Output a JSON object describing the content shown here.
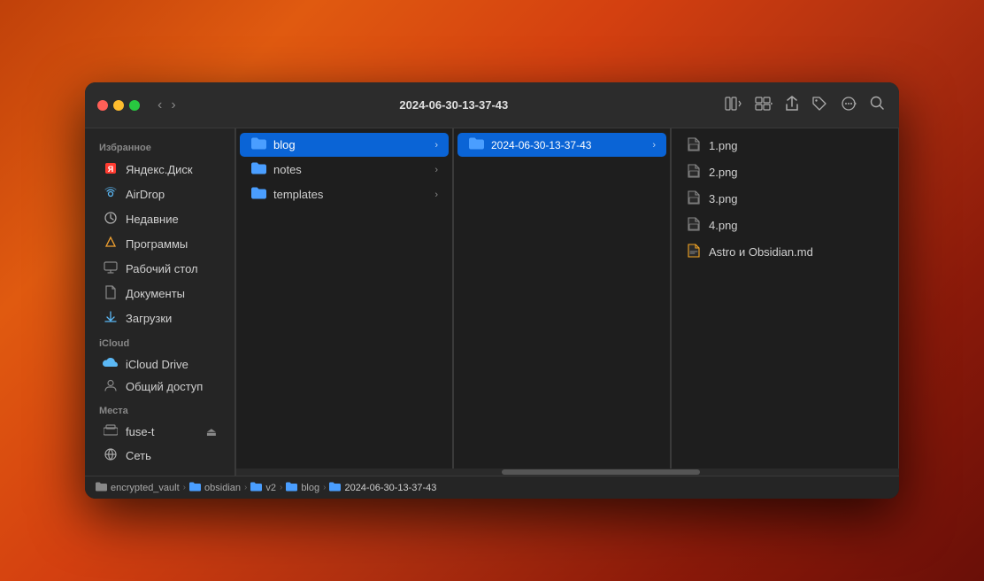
{
  "window": {
    "title": "2024-06-30-13-37-43",
    "traffic_lights": {
      "close_label": "close",
      "minimize_label": "minimize",
      "maximize_label": "maximize"
    }
  },
  "toolbar": {
    "back_label": "‹",
    "forward_label": "›",
    "title": "2024-06-30-13-37-43",
    "share_icon": "↑",
    "tag_icon": "⌲",
    "action_icon": "☺",
    "search_icon": "⌕"
  },
  "sidebar": {
    "sections": [
      {
        "header": "Избранное",
        "items": [
          {
            "id": "yandex-disk",
            "label": "Яндекс.Диск",
            "icon": "🔴"
          },
          {
            "id": "airdrop",
            "label": "AirDrop",
            "icon": "📡"
          },
          {
            "id": "recent",
            "label": "Недавние",
            "icon": "🕐"
          },
          {
            "id": "apps",
            "label": "Программы",
            "icon": "🔺"
          },
          {
            "id": "desktop",
            "label": "Рабочий стол",
            "icon": "🖥"
          },
          {
            "id": "documents",
            "label": "Документы",
            "icon": "📄"
          },
          {
            "id": "downloads",
            "label": "Загрузки",
            "icon": "⬇"
          }
        ]
      },
      {
        "header": "iCloud",
        "items": [
          {
            "id": "icloud-drive",
            "label": "iCloud Drive",
            "icon": "☁"
          },
          {
            "id": "shared",
            "label": "Общий доступ",
            "icon": "📁"
          }
        ]
      },
      {
        "header": "Места",
        "items": [
          {
            "id": "fuse-t",
            "label": "fuse-t",
            "icon": "🖥"
          },
          {
            "id": "network",
            "label": "Сеть",
            "icon": "🌐"
          }
        ]
      }
    ]
  },
  "column1": {
    "items": [
      {
        "id": "blog",
        "label": "blog",
        "selected": true,
        "has_children": true
      },
      {
        "id": "notes",
        "label": "notes",
        "selected": false,
        "has_children": true
      },
      {
        "id": "templates",
        "label": "templates",
        "selected": false,
        "has_children": true
      }
    ]
  },
  "column2": {
    "items": [
      {
        "id": "2024-06-30",
        "label": "2024-06-30-13-37-43",
        "selected": true,
        "has_children": true
      }
    ]
  },
  "column3": {
    "items": [
      {
        "id": "1png",
        "label": "1.png",
        "type": "png"
      },
      {
        "id": "2png",
        "label": "2.png",
        "type": "png"
      },
      {
        "id": "3png",
        "label": "3.png",
        "type": "png"
      },
      {
        "id": "4png",
        "label": "4.png",
        "type": "png"
      },
      {
        "id": "astro-md",
        "label": "Astro и Obsidian.md",
        "type": "md"
      }
    ]
  },
  "statusbar": {
    "breadcrumbs": [
      {
        "label": "encrypted_vault",
        "is_folder": true
      },
      {
        "label": "obsidian",
        "is_folder": true
      },
      {
        "label": "v2",
        "is_folder": true
      },
      {
        "label": "blog",
        "is_folder": true
      },
      {
        "label": "2024-06-30-13-37-43",
        "is_folder": true,
        "active": true
      }
    ]
  },
  "icons": {
    "folder": "📁",
    "folder_blue": "📂",
    "png_file": "🖼",
    "md_file": "📝",
    "arrow_right": "›",
    "breadcrumb_sep": "›"
  }
}
